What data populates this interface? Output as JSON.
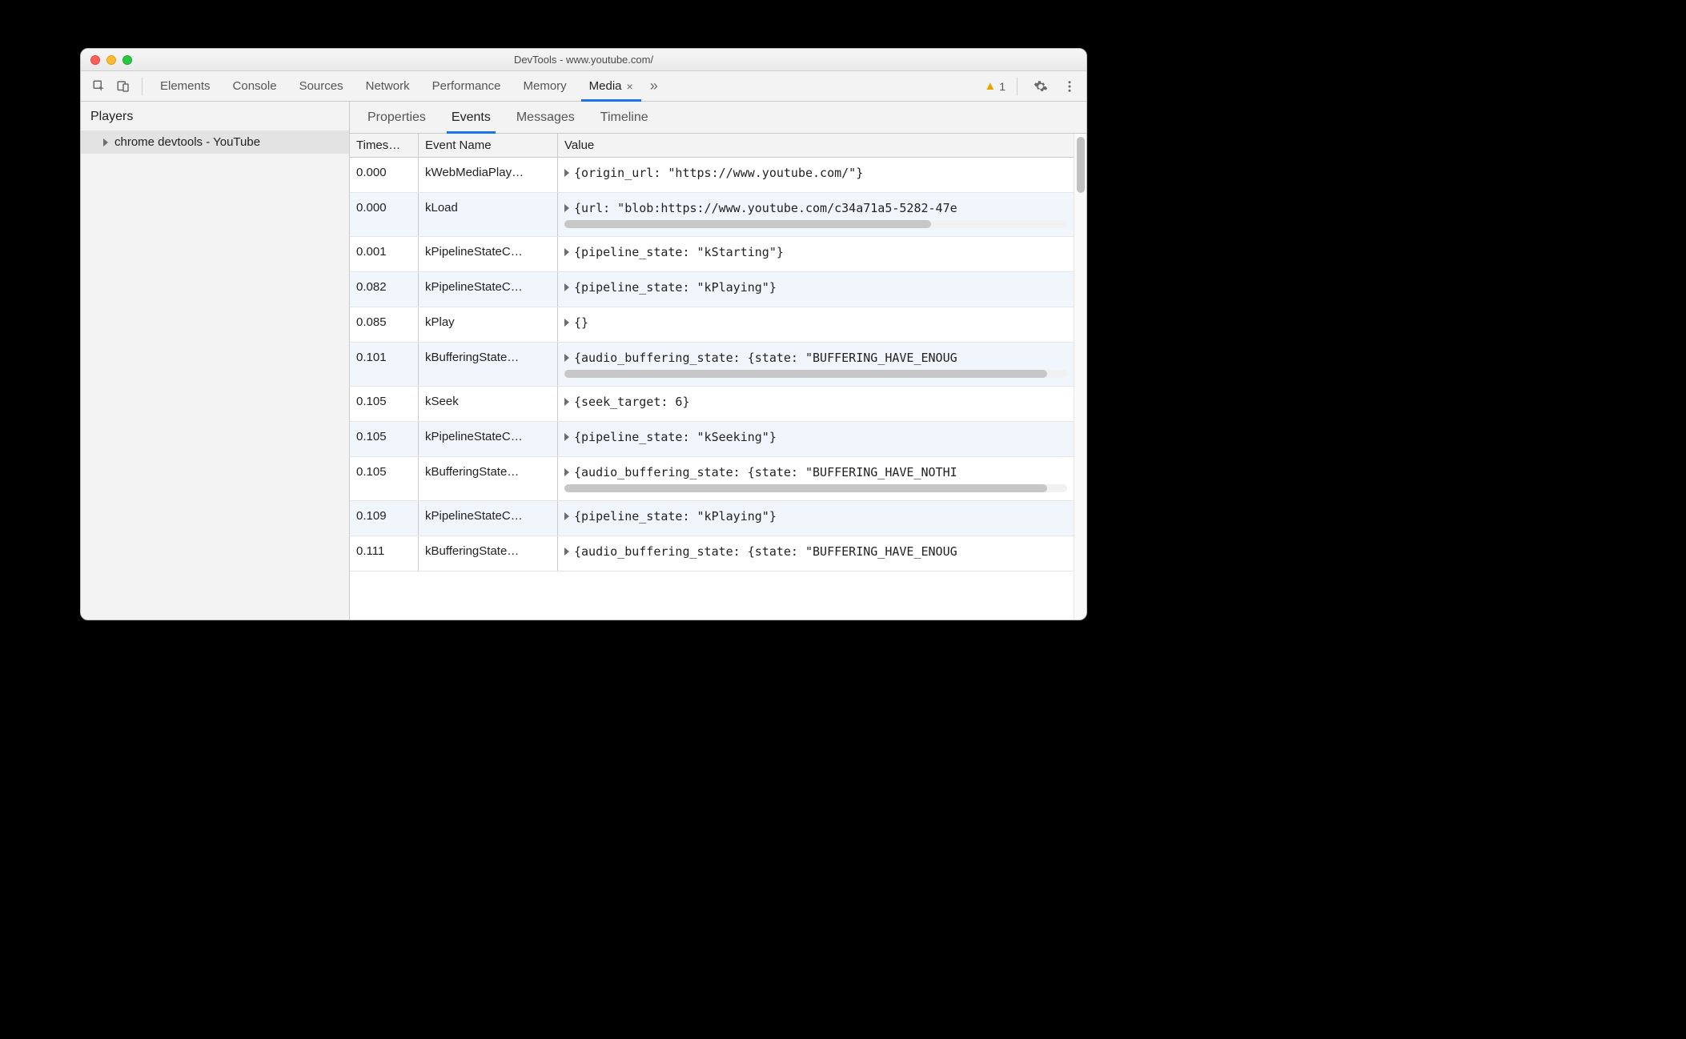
{
  "window": {
    "title": "DevTools - www.youtube.com/"
  },
  "toolbar": {
    "panels": [
      "Elements",
      "Console",
      "Sources",
      "Network",
      "Performance",
      "Memory",
      "Media"
    ],
    "active_panel": "Media",
    "overflow_glyph": "»",
    "warning_count": "1"
  },
  "sidebar": {
    "title": "Players",
    "player_label": "chrome devtools - YouTube"
  },
  "subtabs": {
    "items": [
      "Properties",
      "Events",
      "Messages",
      "Timeline"
    ],
    "active": "Events"
  },
  "table": {
    "headers": {
      "timestamp": "Times…",
      "event_name": "Event Name",
      "value": "Value"
    },
    "rows": [
      {
        "timestamp": "0.000",
        "event_name": "kWebMediaPlay…",
        "value": "{origin_url: \"https://www.youtube.com/\"}",
        "overflow": false
      },
      {
        "timestamp": "0.000",
        "event_name": "kLoad",
        "value": "{url: \"blob:https://www.youtube.com/c34a71a5-5282-47e",
        "overflow": true,
        "thumb_pct": 73
      },
      {
        "timestamp": "0.001",
        "event_name": "kPipelineStateC…",
        "value": "{pipeline_state: \"kStarting\"}",
        "overflow": false
      },
      {
        "timestamp": "0.082",
        "event_name": "kPipelineStateC…",
        "value": "{pipeline_state: \"kPlaying\"}",
        "overflow": false
      },
      {
        "timestamp": "0.085",
        "event_name": "kPlay",
        "value": "{}",
        "overflow": false
      },
      {
        "timestamp": "0.101",
        "event_name": "kBufferingState…",
        "value": "{audio_buffering_state: {state: \"BUFFERING_HAVE_ENOUG",
        "overflow": true,
        "thumb_pct": 96
      },
      {
        "timestamp": "0.105",
        "event_name": "kSeek",
        "value": "{seek_target: 6}",
        "overflow": false
      },
      {
        "timestamp": "0.105",
        "event_name": "kPipelineStateC…",
        "value": "{pipeline_state: \"kSeeking\"}",
        "overflow": false
      },
      {
        "timestamp": "0.105",
        "event_name": "kBufferingState…",
        "value": "{audio_buffering_state: {state: \"BUFFERING_HAVE_NOTHI",
        "overflow": true,
        "thumb_pct": 96
      },
      {
        "timestamp": "0.109",
        "event_name": "kPipelineStateC…",
        "value": "{pipeline_state: \"kPlaying\"}",
        "overflow": false
      },
      {
        "timestamp": "0.111",
        "event_name": "kBufferingState…",
        "value": "{audio_buffering_state: {state: \"BUFFERING_HAVE_ENOUG",
        "overflow": false
      }
    ]
  }
}
